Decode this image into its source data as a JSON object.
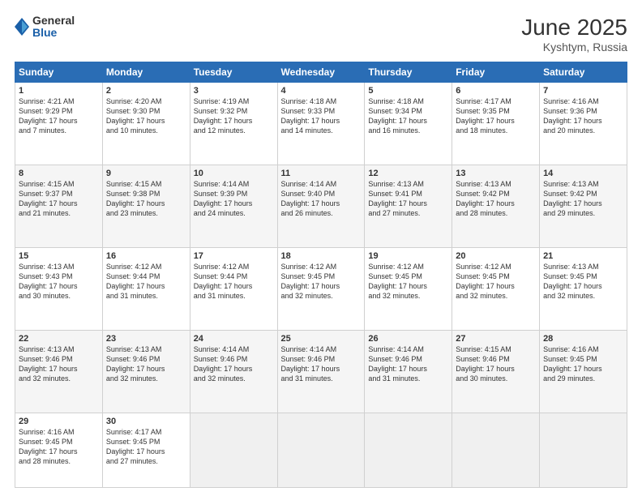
{
  "header": {
    "logo_general": "General",
    "logo_blue": "Blue",
    "month_title": "June 2025",
    "location": "Kyshtym, Russia"
  },
  "weekdays": [
    "Sunday",
    "Monday",
    "Tuesday",
    "Wednesday",
    "Thursday",
    "Friday",
    "Saturday"
  ],
  "weeks": [
    [
      {
        "day": "1",
        "lines": [
          "Sunrise: 4:21 AM",
          "Sunset: 9:29 PM",
          "Daylight: 17 hours",
          "and 7 minutes."
        ]
      },
      {
        "day": "2",
        "lines": [
          "Sunrise: 4:20 AM",
          "Sunset: 9:30 PM",
          "Daylight: 17 hours",
          "and 10 minutes."
        ]
      },
      {
        "day": "3",
        "lines": [
          "Sunrise: 4:19 AM",
          "Sunset: 9:32 PM",
          "Daylight: 17 hours",
          "and 12 minutes."
        ]
      },
      {
        "day": "4",
        "lines": [
          "Sunrise: 4:18 AM",
          "Sunset: 9:33 PM",
          "Daylight: 17 hours",
          "and 14 minutes."
        ]
      },
      {
        "day": "5",
        "lines": [
          "Sunrise: 4:18 AM",
          "Sunset: 9:34 PM",
          "Daylight: 17 hours",
          "and 16 minutes."
        ]
      },
      {
        "day": "6",
        "lines": [
          "Sunrise: 4:17 AM",
          "Sunset: 9:35 PM",
          "Daylight: 17 hours",
          "and 18 minutes."
        ]
      },
      {
        "day": "7",
        "lines": [
          "Sunrise: 4:16 AM",
          "Sunset: 9:36 PM",
          "Daylight: 17 hours",
          "and 20 minutes."
        ]
      }
    ],
    [
      {
        "day": "8",
        "lines": [
          "Sunrise: 4:15 AM",
          "Sunset: 9:37 PM",
          "Daylight: 17 hours",
          "and 21 minutes."
        ]
      },
      {
        "day": "9",
        "lines": [
          "Sunrise: 4:15 AM",
          "Sunset: 9:38 PM",
          "Daylight: 17 hours",
          "and 23 minutes."
        ]
      },
      {
        "day": "10",
        "lines": [
          "Sunrise: 4:14 AM",
          "Sunset: 9:39 PM",
          "Daylight: 17 hours",
          "and 24 minutes."
        ]
      },
      {
        "day": "11",
        "lines": [
          "Sunrise: 4:14 AM",
          "Sunset: 9:40 PM",
          "Daylight: 17 hours",
          "and 26 minutes."
        ]
      },
      {
        "day": "12",
        "lines": [
          "Sunrise: 4:13 AM",
          "Sunset: 9:41 PM",
          "Daylight: 17 hours",
          "and 27 minutes."
        ]
      },
      {
        "day": "13",
        "lines": [
          "Sunrise: 4:13 AM",
          "Sunset: 9:42 PM",
          "Daylight: 17 hours",
          "and 28 minutes."
        ]
      },
      {
        "day": "14",
        "lines": [
          "Sunrise: 4:13 AM",
          "Sunset: 9:42 PM",
          "Daylight: 17 hours",
          "and 29 minutes."
        ]
      }
    ],
    [
      {
        "day": "15",
        "lines": [
          "Sunrise: 4:13 AM",
          "Sunset: 9:43 PM",
          "Daylight: 17 hours",
          "and 30 minutes."
        ]
      },
      {
        "day": "16",
        "lines": [
          "Sunrise: 4:12 AM",
          "Sunset: 9:44 PM",
          "Daylight: 17 hours",
          "and 31 minutes."
        ]
      },
      {
        "day": "17",
        "lines": [
          "Sunrise: 4:12 AM",
          "Sunset: 9:44 PM",
          "Daylight: 17 hours",
          "and 31 minutes."
        ]
      },
      {
        "day": "18",
        "lines": [
          "Sunrise: 4:12 AM",
          "Sunset: 9:45 PM",
          "Daylight: 17 hours",
          "and 32 minutes."
        ]
      },
      {
        "day": "19",
        "lines": [
          "Sunrise: 4:12 AM",
          "Sunset: 9:45 PM",
          "Daylight: 17 hours",
          "and 32 minutes."
        ]
      },
      {
        "day": "20",
        "lines": [
          "Sunrise: 4:12 AM",
          "Sunset: 9:45 PM",
          "Daylight: 17 hours",
          "and 32 minutes."
        ]
      },
      {
        "day": "21",
        "lines": [
          "Sunrise: 4:13 AM",
          "Sunset: 9:45 PM",
          "Daylight: 17 hours",
          "and 32 minutes."
        ]
      }
    ],
    [
      {
        "day": "22",
        "lines": [
          "Sunrise: 4:13 AM",
          "Sunset: 9:46 PM",
          "Daylight: 17 hours",
          "and 32 minutes."
        ]
      },
      {
        "day": "23",
        "lines": [
          "Sunrise: 4:13 AM",
          "Sunset: 9:46 PM",
          "Daylight: 17 hours",
          "and 32 minutes."
        ]
      },
      {
        "day": "24",
        "lines": [
          "Sunrise: 4:14 AM",
          "Sunset: 9:46 PM",
          "Daylight: 17 hours",
          "and 32 minutes."
        ]
      },
      {
        "day": "25",
        "lines": [
          "Sunrise: 4:14 AM",
          "Sunset: 9:46 PM",
          "Daylight: 17 hours",
          "and 31 minutes."
        ]
      },
      {
        "day": "26",
        "lines": [
          "Sunrise: 4:14 AM",
          "Sunset: 9:46 PM",
          "Daylight: 17 hours",
          "and 31 minutes."
        ]
      },
      {
        "day": "27",
        "lines": [
          "Sunrise: 4:15 AM",
          "Sunset: 9:46 PM",
          "Daylight: 17 hours",
          "and 30 minutes."
        ]
      },
      {
        "day": "28",
        "lines": [
          "Sunrise: 4:16 AM",
          "Sunset: 9:45 PM",
          "Daylight: 17 hours",
          "and 29 minutes."
        ]
      }
    ],
    [
      {
        "day": "29",
        "lines": [
          "Sunrise: 4:16 AM",
          "Sunset: 9:45 PM",
          "Daylight: 17 hours",
          "and 28 minutes."
        ]
      },
      {
        "day": "30",
        "lines": [
          "Sunrise: 4:17 AM",
          "Sunset: 9:45 PM",
          "Daylight: 17 hours",
          "and 27 minutes."
        ]
      },
      {
        "day": "",
        "lines": []
      },
      {
        "day": "",
        "lines": []
      },
      {
        "day": "",
        "lines": []
      },
      {
        "day": "",
        "lines": []
      },
      {
        "day": "",
        "lines": []
      }
    ]
  ]
}
